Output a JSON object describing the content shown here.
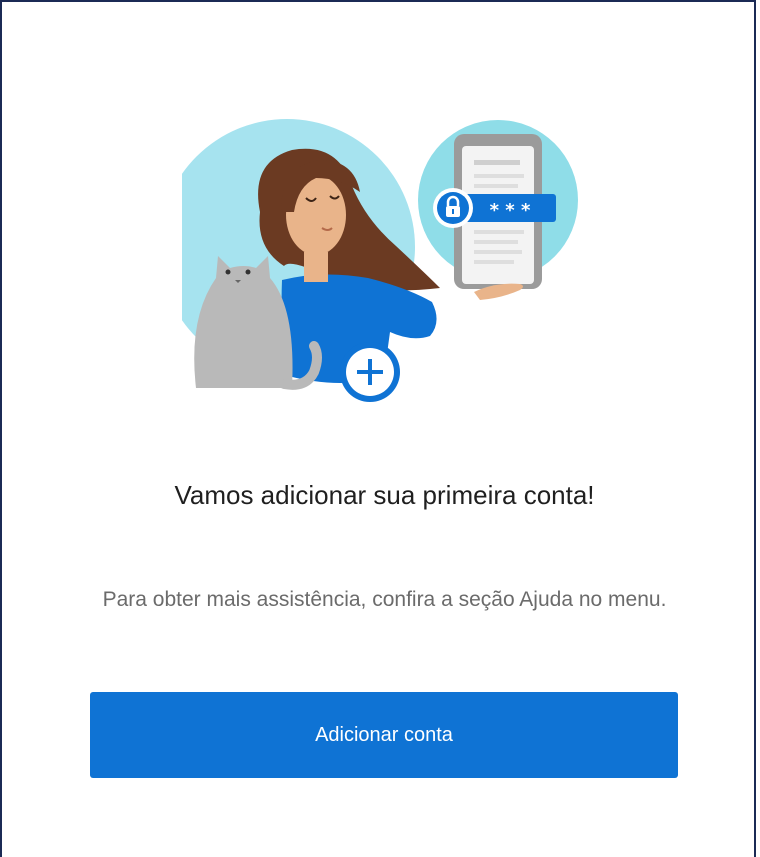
{
  "onboarding": {
    "title": "Vamos adicionar sua primeira conta!",
    "subtitle": "Para obter mais assistência, confira a seção Ajuda no menu.",
    "add_account_label": "Adicionar conta",
    "password_mask": "* * *"
  },
  "colors": {
    "accent": "#0f73d4",
    "circle_light": "#a6e3ef",
    "title_text": "#1f1f1f",
    "subtitle_text": "#6b6b6b"
  },
  "icons": {
    "lock": "lock-icon",
    "plus": "plus-icon"
  }
}
